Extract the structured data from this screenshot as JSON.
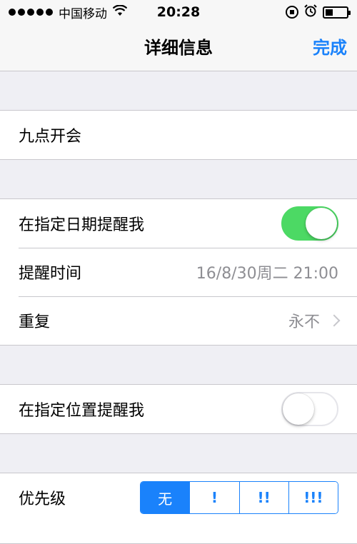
{
  "status_bar": {
    "carrier": "中国移动",
    "time": "20:28"
  },
  "nav": {
    "title": "详细信息",
    "done_label": "完成"
  },
  "title_row": {
    "text": "九点开会"
  },
  "date_group": {
    "remind_on_date_label": "在指定日期提醒我",
    "remind_on_date_enabled": true,
    "alarm_label": "提醒时间",
    "alarm_value": "16/8/30周二 21:00",
    "repeat_label": "重复",
    "repeat_value": "永不"
  },
  "location_group": {
    "remind_at_location_label": "在指定位置提醒我",
    "remind_at_location_enabled": false
  },
  "priority": {
    "label": "优先级",
    "options": [
      "无",
      "!",
      "!!",
      "!!!"
    ],
    "selected_index": 0
  },
  "colors": {
    "accent": "#1a82fb",
    "toggle_on": "#4cd964",
    "background": "#efeff4",
    "separator": "#c8c7cc",
    "secondary_text": "#8e8e93"
  }
}
